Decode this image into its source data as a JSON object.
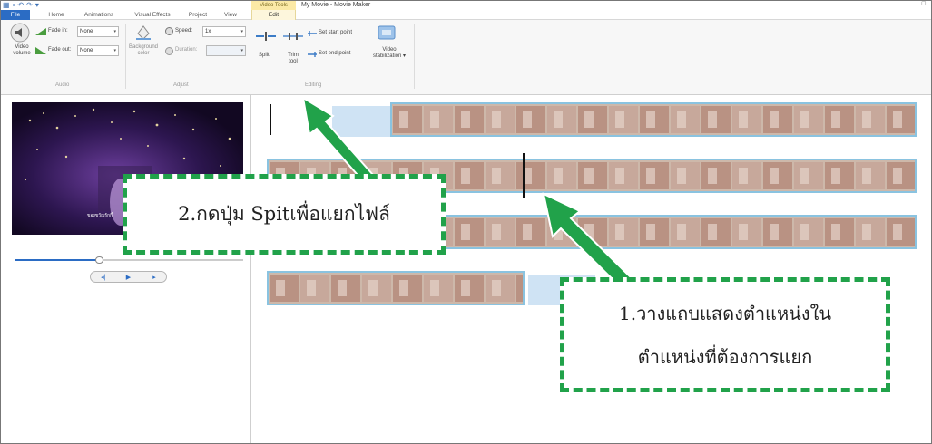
{
  "window": {
    "title": "My Movie - Movie Maker",
    "context_tab": "Video Tools",
    "minimize_glyph": "−",
    "maximize_glyph": "□"
  },
  "quick_access": {
    "icons": [
      "app-icon",
      "save-icon",
      "undo-icon",
      "redo-icon",
      "customize-icon"
    ]
  },
  "tabs": [
    "File",
    "Home",
    "Animations",
    "Visual Effects",
    "Project",
    "View",
    "Edit"
  ],
  "ribbon": {
    "audio": {
      "volume_label": "Video volume",
      "fade_in_label": "Fade in:",
      "fade_in_value": "None",
      "fade_out_label": "Fade out:",
      "fade_out_value": "None",
      "group_label": "Audio"
    },
    "adjust": {
      "background_color_label": "Background color",
      "speed_label": "Speed:",
      "speed_value": "1x",
      "duration_label": "Duration:",
      "duration_value": "",
      "group_label": "Adjust"
    },
    "editing": {
      "split_label": "Split",
      "trim_label": "Trim tool",
      "set_start_label": "Set start point",
      "set_end_label": "Set end point",
      "group_label": "Editing"
    },
    "stabilization": {
      "label": "Video stabilization"
    }
  },
  "preview": {
    "caption": "ของขวัญรักกี้",
    "seek_position": 0.37
  },
  "annotations": {
    "step1_line1": "1.วางแถบแสดงตำแหน่งใน",
    "step1_line2": "ตำแหน่งที่ต้องการแยก",
    "step2": "2.กดปุ่ม Spitเพื่อแยกไฟล์",
    "accent_color": "#21a24a"
  }
}
